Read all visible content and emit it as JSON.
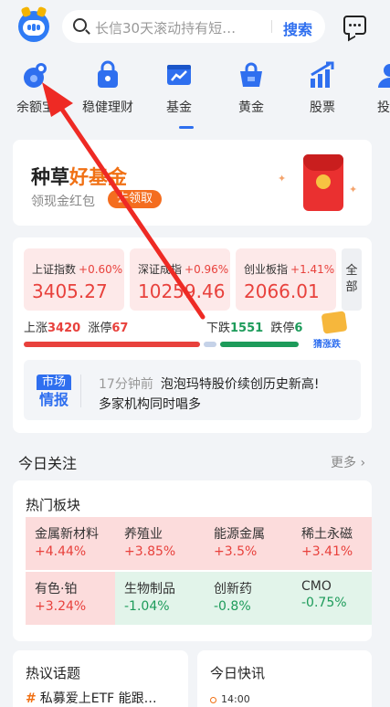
{
  "topbar": {
    "search_placeholder": "长信30天滚动持有短…",
    "search_button": "搜索"
  },
  "nav": {
    "items": [
      {
        "label": "余额宝",
        "icon": "yuebao-icon"
      },
      {
        "label": "稳健理财",
        "icon": "lock-bag-icon"
      },
      {
        "label": "基金",
        "icon": "fund-chart-icon"
      },
      {
        "label": "黄金",
        "icon": "gold-basket-icon"
      },
      {
        "label": "股票",
        "icon": "stock-arrow-icon"
      },
      {
        "label": "投顾",
        "icon": "advisor-icon"
      }
    ],
    "active_index": 2
  },
  "promo": {
    "title_prefix": "种草",
    "title_highlight": "好基金",
    "subtitle": "领现金红包",
    "button": "去领取"
  },
  "market": {
    "indices": [
      {
        "name": "上证指数",
        "change": "+0.60%",
        "value": "3405.27"
      },
      {
        "name": "深证成指",
        "change": "+0.96%",
        "value": "10259.46"
      },
      {
        "name": "创业板指",
        "change": "+1.41%",
        "value": "2066.01"
      }
    ],
    "all_label": "全部",
    "rise_label": "上涨",
    "rise_count": "3420",
    "limit_up_label": "涨停",
    "limit_up_count": "67",
    "fall_label": "下跌",
    "fall_count": "1551",
    "limit_down_label": "跌停",
    "limit_down_count": "6",
    "guess_label": "猜涨跌",
    "rise_share": 0.69,
    "colors": {
      "up": "#e8413c",
      "down": "#1d9b5a"
    }
  },
  "news": {
    "logo_top": "市场",
    "logo_bottom": "情报",
    "time": "17分钟前",
    "line1": "泡泡玛特股价续创历史新高!",
    "line2": "多家机构同时唱多"
  },
  "today": {
    "title": "今日关注",
    "more": "更多"
  },
  "hot_sectors": {
    "title": "热门板块",
    "cells": [
      {
        "name": "金属新材料",
        "pct": "+4.44%",
        "dir": "up"
      },
      {
        "name": "养殖业",
        "pct": "+3.85%",
        "dir": "up"
      },
      {
        "name": "能源金属",
        "pct": "+3.5%",
        "dir": "up"
      },
      {
        "name": "稀土永磁",
        "pct": "+3.41%",
        "dir": "up"
      },
      {
        "name": "有色·铂",
        "pct": "+3.24%",
        "dir": "up"
      },
      {
        "name": "生物制品",
        "pct": "-1.04%",
        "dir": "down"
      },
      {
        "name": "创新药",
        "pct": "-0.8%",
        "dir": "down"
      },
      {
        "name": "CMO",
        "pct": "-0.75%",
        "dir": "down"
      }
    ]
  },
  "topics": {
    "title": "热议话题",
    "item": "私募爱上ETF 能跟…",
    "hash": "#"
  },
  "flash": {
    "title": "今日快讯",
    "time": "14:00"
  }
}
